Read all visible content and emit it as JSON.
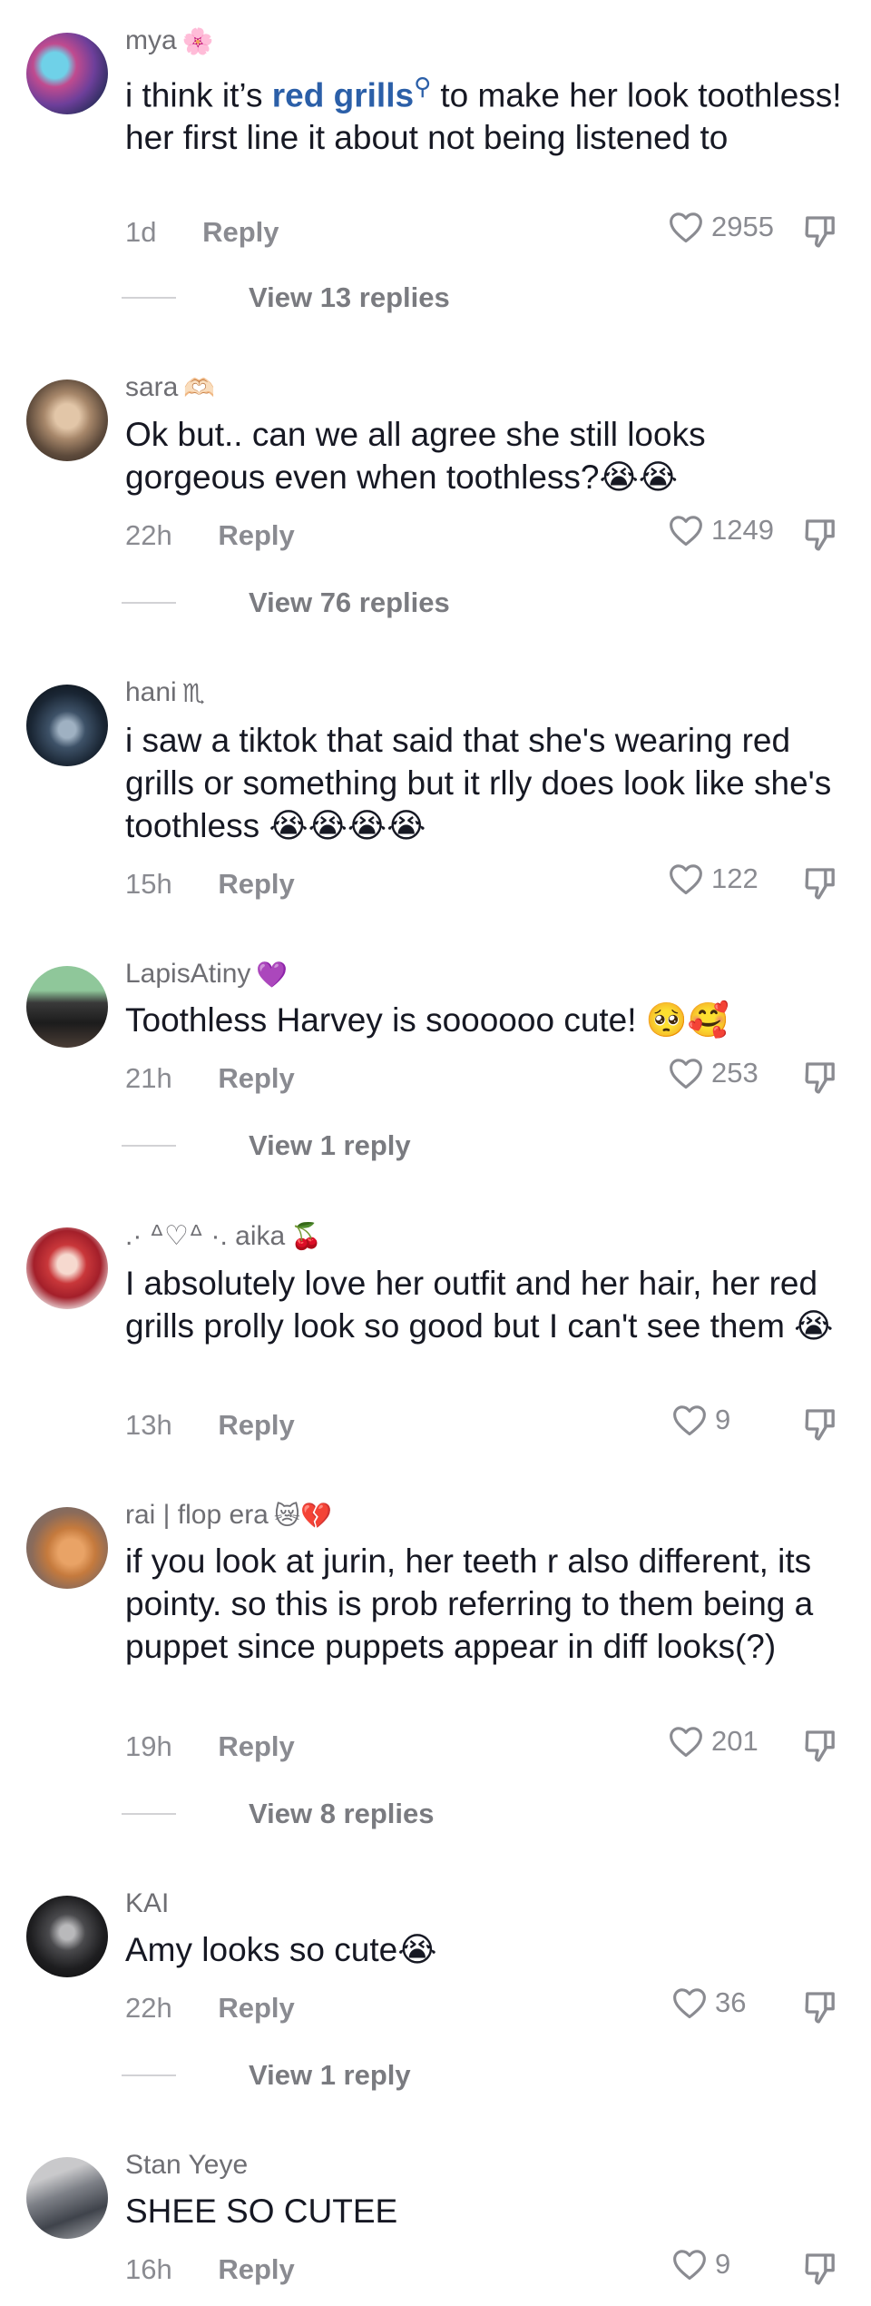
{
  "comments": [
    {
      "username": "mya",
      "username_emoji": "🌸",
      "text_before": "i think it’s ",
      "link": "red grills",
      "text_after": " to make her look toothless! her first line it about not being listened to",
      "time": "1d",
      "reply_label": "Reply",
      "likes": "2955",
      "view_replies": "View 13 replies"
    },
    {
      "username": "sara",
      "username_emoji": "🫶🏻",
      "text": "Ok but.. can we all agree she still looks gorgeous even when toothless?😭😭",
      "time": "22h",
      "reply_label": "Reply",
      "likes": "1249",
      "view_replies": "View 76 replies"
    },
    {
      "username": "hani",
      "username_emoji": "♏",
      "text": "i saw a tiktok that said that she's wearing red grills or something but it rlly does look like she's toothless 😭😭😭😭",
      "time": "15h",
      "reply_label": "Reply",
      "likes": "122"
    },
    {
      "username": "LapisAtiny",
      "username_emoji": "💜",
      "text": "Toothless Harvey is soooooo cute! 🥺🥰",
      "time": "21h",
      "reply_label": "Reply",
      "likes": "253",
      "view_replies": "View 1 reply"
    },
    {
      "username": ".· ᐞ♡ᐞ ·. aika",
      "username_emoji": "🍒",
      "text": "I absolutely love her outfit and her hair, her red grills prolly look so good but I can't see them 😭",
      "time": "13h",
      "reply_label": "Reply",
      "likes": "9"
    },
    {
      "username": "rai | flop era",
      "username_emoji": "😿💔",
      "text": "if you look at jurin, her teeth r also different, its pointy. so this is prob referring to them being a puppet since puppets appear in diff looks(?)",
      "time": "19h",
      "reply_label": "Reply",
      "likes": "201",
      "view_replies": "View 8 replies"
    },
    {
      "username": "KAI",
      "username_emoji": "",
      "text": "Amy looks so cute😭",
      "time": "22h",
      "reply_label": "Reply",
      "likes": "36",
      "view_replies": "View 1 reply"
    },
    {
      "username": "Stan Yeye",
      "username_emoji": "",
      "text": "SHEE SO CUTEE",
      "time": "16h",
      "reply_label": "Reply",
      "likes": "9"
    }
  ],
  "icons": {
    "like": "heart-outline-icon",
    "dislike": "thumbs-down-icon",
    "search": "search-icon"
  },
  "colors": {
    "link": "#2b5fa8",
    "meta": "#8a8b91",
    "text": "#161823"
  }
}
